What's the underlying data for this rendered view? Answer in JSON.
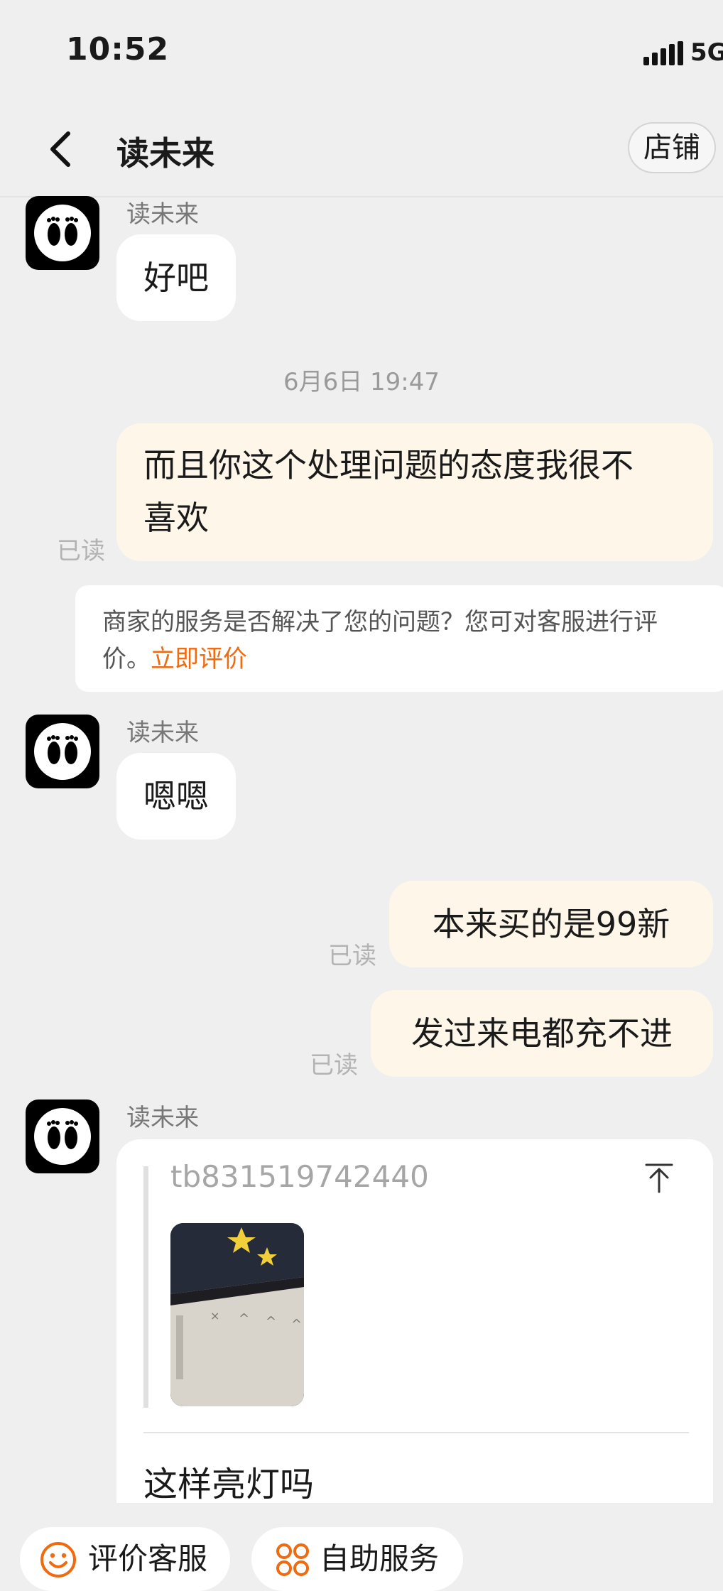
{
  "status_bar": {
    "time": "10:52",
    "network": "5G"
  },
  "nav": {
    "title": "读未来",
    "shop_label": "店铺"
  },
  "messages": {
    "m1": {
      "sender": "读未来",
      "text": "好吧"
    },
    "timestamp": "6月6日 19:47",
    "m2": {
      "line1": "而且你这个处理问题的态度我很不",
      "line2": "喜欢",
      "read": "已读"
    },
    "notice": {
      "line1": "商家的服务是否解决了您的问题？您可对客服进行评",
      "line2_prefix": "价。",
      "link": "立即评价"
    },
    "m3": {
      "sender": "读未来",
      "text": "嗯嗯"
    },
    "m4": {
      "text": "本来买的是99新",
      "read": "已读"
    },
    "m5": {
      "text": "发过来电都充不进",
      "read": "已读"
    },
    "m6": {
      "sender": "读未来",
      "quote_id": "tb831519742440",
      "text": "这样亮灯吗"
    }
  },
  "bottom_actions": [
    {
      "label": "评价客服",
      "icon": "smile-icon"
    },
    {
      "label": "自助服务",
      "icon": "grid-icon"
    }
  ],
  "colors": {
    "accent": "#f06a0f",
    "outgoing_bubble": "#fdf6e9",
    "background": "#efefef"
  }
}
